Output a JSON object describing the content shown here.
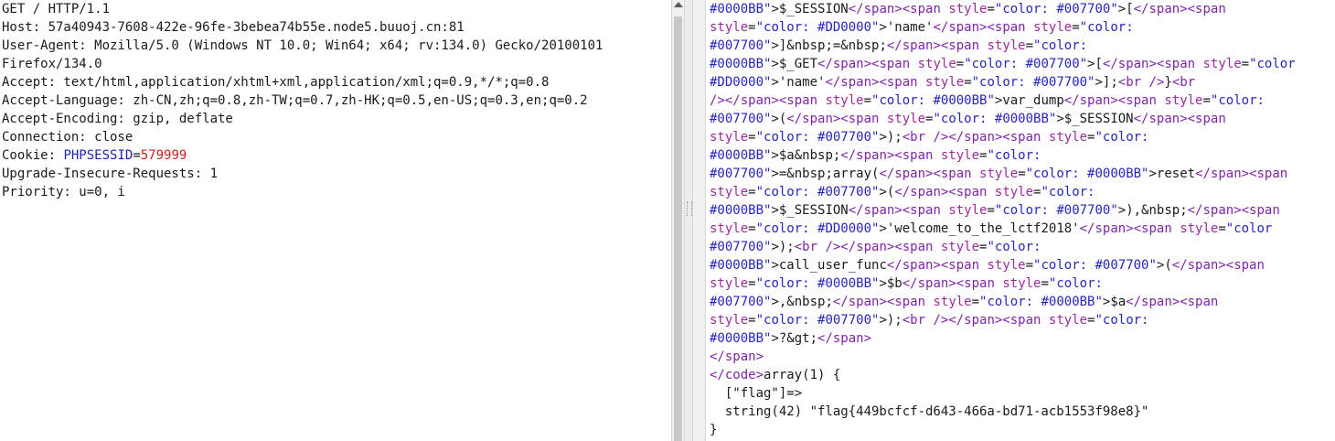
{
  "request": {
    "lines": [
      "GET / HTTP/1.1",
      "Host: 57a40943-7608-422e-96fe-3bebea74b55e.node5.buuoj.cn:81",
      "User-Agent: Mozilla/5.0 (Windows NT 10.0; Win64; x64; rv:134.0) Gecko/20100101",
      "Firefox/134.0",
      "Accept: text/html,application/xhtml+xml,application/xml;q=0.9,*/*;q=0.8",
      "Accept-Language: zh-CN,zh;q=0.8,zh-TW;q=0.7,zh-HK;q=0.5,en-US;q=0.3,en;q=0.2",
      "Accept-Encoding: gzip, deflate",
      "Connection: close"
    ],
    "cookie_label": "Cookie: ",
    "cookie_name": "PHPSESSID",
    "cookie_eq": "=",
    "cookie_value": "579999",
    "lines_after": [
      "Upgrade-Insecure-Requests: 1",
      "Priority: u=0, i"
    ]
  },
  "response": {
    "lines": [
      [
        [
          "val",
          "#0000BB\""
        ],
        [
          "tx",
          ">$_SESSION"
        ],
        [
          "tag",
          "</span><span"
        ],
        [
          "attr",
          " style"
        ],
        [
          "tx",
          "="
        ],
        [
          "val",
          "\"color: #007700\""
        ],
        [
          "tx",
          ">["
        ],
        [
          "tag",
          "</span><span"
        ]
      ],
      [
        [
          "attr",
          "style"
        ],
        [
          "tx",
          "="
        ],
        [
          "val",
          "\"color: #DD0000\""
        ],
        [
          "tx",
          ">'name'"
        ],
        [
          "tag",
          "</span><span"
        ],
        [
          "attr",
          " style"
        ],
        [
          "tx",
          "="
        ],
        [
          "val",
          "\"color:"
        ]
      ],
      [
        [
          "val",
          "#007700\""
        ],
        [
          "tx",
          ">]&nbsp;=&nbsp;"
        ],
        [
          "tag",
          "</span><span"
        ],
        [
          "attr",
          " style"
        ],
        [
          "tx",
          "="
        ],
        [
          "val",
          "\"color:"
        ]
      ],
      [
        [
          "val",
          "#0000BB\""
        ],
        [
          "tx",
          ">$_GET"
        ],
        [
          "tag",
          "</span><span"
        ],
        [
          "attr",
          " style"
        ],
        [
          "tx",
          "="
        ],
        [
          "val",
          "\"color: #007700\""
        ],
        [
          "tx",
          ">["
        ],
        [
          "tag",
          "</span><span"
        ],
        [
          "attr",
          " style"
        ],
        [
          "tx",
          "="
        ],
        [
          "val",
          "\"color"
        ]
      ],
      [
        [
          "val",
          "#DD0000\""
        ],
        [
          "tx",
          ">'name'"
        ],
        [
          "tag",
          "</span><span"
        ],
        [
          "attr",
          " style"
        ],
        [
          "tx",
          "="
        ],
        [
          "val",
          "\"color: #007700\""
        ],
        [
          "tx",
          ">];"
        ],
        [
          "tag",
          "<br />"
        ],
        [
          "tx",
          "}"
        ],
        [
          "tag",
          "<br"
        ]
      ],
      [
        [
          "tag",
          "/></span><span"
        ],
        [
          "attr",
          " style"
        ],
        [
          "tx",
          "="
        ],
        [
          "val",
          "\"color: #0000BB\""
        ],
        [
          "tx",
          ">var_dump"
        ],
        [
          "tag",
          "</span><span"
        ],
        [
          "attr",
          " style"
        ],
        [
          "tx",
          "="
        ],
        [
          "val",
          "\"color:"
        ]
      ],
      [
        [
          "val",
          "#007700\""
        ],
        [
          "tx",
          ">("
        ],
        [
          "tag",
          "</span><span"
        ],
        [
          "attr",
          " style"
        ],
        [
          "tx",
          "="
        ],
        [
          "val",
          "\"color: #0000BB\""
        ],
        [
          "tx",
          ">$_SESSION"
        ],
        [
          "tag",
          "</span><span"
        ]
      ],
      [
        [
          "attr",
          "style"
        ],
        [
          "tx",
          "="
        ],
        [
          "val",
          "\"color: #007700\""
        ],
        [
          "tx",
          ">);"
        ],
        [
          "tag",
          "<br /></span><span"
        ],
        [
          "attr",
          " style"
        ],
        [
          "tx",
          "="
        ],
        [
          "val",
          "\"color:"
        ]
      ],
      [
        [
          "val",
          "#0000BB\""
        ],
        [
          "tx",
          ">$a&nbsp;"
        ],
        [
          "tag",
          "</span><span"
        ],
        [
          "attr",
          " style"
        ],
        [
          "tx",
          "="
        ],
        [
          "val",
          "\"color:"
        ]
      ],
      [
        [
          "val",
          "#007700\""
        ],
        [
          "tx",
          ">=&nbsp;array("
        ],
        [
          "tag",
          "</span><span"
        ],
        [
          "attr",
          " style"
        ],
        [
          "tx",
          "="
        ],
        [
          "val",
          "\"color: #0000BB\""
        ],
        [
          "tx",
          ">reset"
        ],
        [
          "tag",
          "</span><span"
        ]
      ],
      [
        [
          "attr",
          "style"
        ],
        [
          "tx",
          "="
        ],
        [
          "val",
          "\"color: #007700\""
        ],
        [
          "tx",
          ">("
        ],
        [
          "tag",
          "</span><span"
        ],
        [
          "attr",
          " style"
        ],
        [
          "tx",
          "="
        ],
        [
          "val",
          "\"color:"
        ]
      ],
      [
        [
          "val",
          "#0000BB\""
        ],
        [
          "tx",
          ">$_SESSION"
        ],
        [
          "tag",
          "</span><span"
        ],
        [
          "attr",
          " style"
        ],
        [
          "tx",
          "="
        ],
        [
          "val",
          "\"color: #007700\""
        ],
        [
          "tx",
          ">),&nbsp;"
        ],
        [
          "tag",
          "</span><span"
        ]
      ],
      [
        [
          "attr",
          "style"
        ],
        [
          "tx",
          "="
        ],
        [
          "val",
          "\"color: #DD0000\""
        ],
        [
          "tx",
          ">'welcome_to_the_lctf2018'"
        ],
        [
          "tag",
          "</span><span"
        ],
        [
          "attr",
          " style"
        ],
        [
          "tx",
          "="
        ],
        [
          "val",
          "\"color"
        ]
      ],
      [
        [
          "val",
          "#007700\""
        ],
        [
          "tx",
          ">);"
        ],
        [
          "tag",
          "<br /></span><span"
        ],
        [
          "attr",
          " style"
        ],
        [
          "tx",
          "="
        ],
        [
          "val",
          "\"color:"
        ]
      ],
      [
        [
          "val",
          "#0000BB\""
        ],
        [
          "tx",
          ">call_user_func"
        ],
        [
          "tag",
          "</span><span"
        ],
        [
          "attr",
          " style"
        ],
        [
          "tx",
          "="
        ],
        [
          "val",
          "\"color: #007700\""
        ],
        [
          "tx",
          ">("
        ],
        [
          "tag",
          "</span><span"
        ]
      ],
      [
        [
          "attr",
          "style"
        ],
        [
          "tx",
          "="
        ],
        [
          "val",
          "\"color: #0000BB\""
        ],
        [
          "tx",
          ">$b"
        ],
        [
          "tag",
          "</span><span"
        ],
        [
          "attr",
          " style"
        ],
        [
          "tx",
          "="
        ],
        [
          "val",
          "\"color:"
        ]
      ],
      [
        [
          "val",
          "#007700\""
        ],
        [
          "tx",
          ">,&nbsp;"
        ],
        [
          "tag",
          "</span><span"
        ],
        [
          "attr",
          " style"
        ],
        [
          "tx",
          "="
        ],
        [
          "val",
          "\"color: #0000BB\""
        ],
        [
          "tx",
          ">$a"
        ],
        [
          "tag",
          "</span><span"
        ]
      ],
      [
        [
          "attr",
          "style"
        ],
        [
          "tx",
          "="
        ],
        [
          "val",
          "\"color: #007700\""
        ],
        [
          "tx",
          ">);"
        ],
        [
          "tag",
          "<br /></span><span"
        ],
        [
          "attr",
          " style"
        ],
        [
          "tx",
          "="
        ],
        [
          "val",
          "\"color:"
        ]
      ],
      [
        [
          "val",
          "#0000BB\""
        ],
        [
          "tx",
          ">?&gt;"
        ],
        [
          "tag",
          "</span>"
        ]
      ],
      [
        [
          "tag",
          "</span>"
        ]
      ],
      [
        [
          "tag",
          "</code>"
        ],
        [
          "tx",
          "array(1) {"
        ]
      ],
      [
        [
          "tx",
          "  [\"flag\"]=>"
        ]
      ],
      [
        [
          "tx",
          "  string(42) \"flag{449bcfcf-d643-466a-bd71-acb1553f98e8}\""
        ]
      ],
      [
        [
          "tx",
          "}"
        ]
      ]
    ]
  }
}
